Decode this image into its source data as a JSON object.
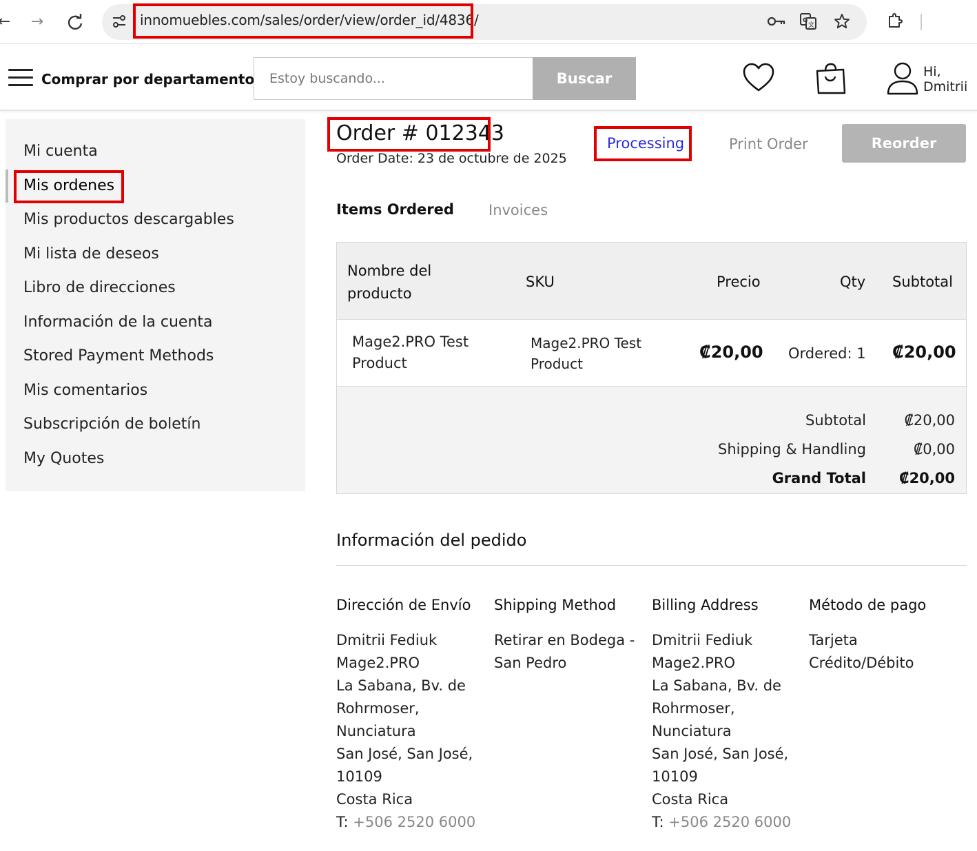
{
  "browser": {
    "url": "innomuebles.com/sales/order/view/order_id/4836/",
    "icons": [
      "back-arrow-icon",
      "forward-arrow-icon",
      "reload-icon",
      "site-settings-icon",
      "key-icon",
      "translate-icon",
      "star-icon",
      "extensions-icon"
    ]
  },
  "header": {
    "department_label": "Comprar por departamento",
    "search_placeholder": "Estoy buscando...",
    "search_button": "Buscar",
    "greeting_line1": "Hi,",
    "greeting_line2": "Dmitrii"
  },
  "sidebar": {
    "items": [
      {
        "label": "Mi cuenta"
      },
      {
        "label": "Mis ordenes",
        "active": true
      },
      {
        "label": "Mis productos descargables"
      },
      {
        "label": "Mi lista de deseos"
      },
      {
        "label": "Libro de direcciones"
      },
      {
        "label": "Información de la cuenta"
      },
      {
        "label": "Stored Payment Methods"
      },
      {
        "label": "Mis comentarios"
      },
      {
        "label": "Subscripción de boletín"
      },
      {
        "label": "My Quotes"
      }
    ]
  },
  "order": {
    "title": "Order # 012343",
    "date": "Order Date: 23 de octubre de 2025",
    "status": "Processing",
    "print_label": "Print Order",
    "reorder_label": "Reorder"
  },
  "tabs": {
    "items_ordered": "Items Ordered",
    "invoices": "Invoices"
  },
  "table": {
    "headers": {
      "name_line1": "Nombre del",
      "name_line2": "producto",
      "sku": "SKU",
      "price": "Precio",
      "qty": "Qty",
      "subtotal": "Subtotal"
    },
    "row": {
      "name_line1": "Mage2.PRO Test",
      "name_line2": "Product",
      "sku_line1": "Mage2.PRO Test",
      "sku_line2": "Product",
      "price": "₡20,00",
      "qty": "Ordered: 1",
      "subtotal": "₡20,00"
    },
    "totals": {
      "subtotal_label": "Subtotal",
      "subtotal_value": "₡20,00",
      "shipping_label": "Shipping & Handling",
      "shipping_value": "₡0,00",
      "grand_label": "Grand Total",
      "grand_value": "₡20,00"
    }
  },
  "info": {
    "title": "Información del pedido",
    "shipping_address": {
      "heading": "Dirección de Envío",
      "lines": [
        "Dmitrii Fediuk",
        "Mage2.PRO",
        "La Sabana, Bv. de",
        "Rohrmoser,",
        "Nunciatura",
        "San José, San José,",
        "10109",
        "Costa Rica"
      ],
      "phone_prefix": "T: ",
      "phone": "+506 2520 6000"
    },
    "shipping_method": {
      "heading": "Shipping Method",
      "lines": [
        "Retirar en Bodega -",
        "San Pedro"
      ]
    },
    "billing_address": {
      "heading": "Billing Address",
      "lines": [
        "Dmitrii Fediuk",
        "Mage2.PRO",
        "La Sabana, Bv. de",
        "Rohrmoser,",
        "Nunciatura",
        "San José, San José,",
        "10109",
        "Costa Rica"
      ],
      "phone_prefix": "T: ",
      "phone": "+506 2520 6000"
    },
    "payment_method": {
      "heading": "Método de pago",
      "lines": [
        "Tarjeta",
        "Crédito/Débito"
      ]
    }
  }
}
